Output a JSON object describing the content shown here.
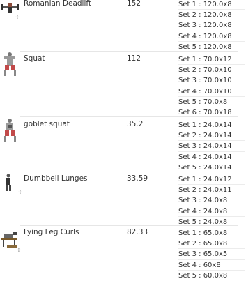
{
  "exercises": [
    {
      "name": "Romanian Deadlift",
      "weight": "152",
      "icon": "deadlift-figure-icon",
      "sets": [
        "Set 1 : 120.0x8",
        "Set 2 : 120.0x8",
        "Set 3 : 120.0x8",
        "Set 4 : 120.0x8",
        "Set 5 : 120.0x8"
      ]
    },
    {
      "name": "Squat",
      "weight": "112",
      "icon": "squat-figure-icon",
      "sets": [
        "Set 1 : 70.0x12",
        "Set 2 : 70.0x10",
        "Set 3 : 70.0x10",
        "Set 4 : 70.0x10",
        "Set 5 : 70.0x8",
        "Set 6 : 70.0x18"
      ]
    },
    {
      "name": "goblet squat",
      "weight": "35.2",
      "icon": "goblet-squat-figure-icon",
      "sets": [
        "Set 1 : 24.0x14",
        "Set 2 : 24.0x14",
        "Set 3 : 24.0x14",
        "Set 4 : 24.0x14",
        "Set 5 : 24.0x14"
      ]
    },
    {
      "name": "Dumbbell Lunges",
      "weight": "33.59",
      "icon": "lunge-figure-icon",
      "sets": [
        "Set 1 : 24.0x12",
        "Set 2 : 24.0x11",
        "Set 3 : 24.0x8",
        "Set 4 : 24.0x8",
        "Set 5 : 24.0x8"
      ]
    },
    {
      "name": "Lying Leg Curls",
      "weight": "82.33",
      "icon": "leg-curl-machine-icon",
      "sets": [
        "Set 1 : 65.0x8",
        "Set 2 : 65.0x8",
        "Set 3 : 65.0x5",
        "Set 4 : 60x8",
        "Set 5 : 60.0x8"
      ]
    }
  ]
}
